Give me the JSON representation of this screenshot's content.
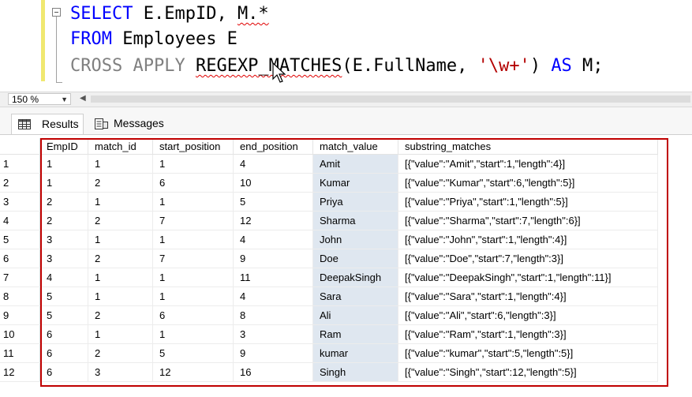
{
  "editor": {
    "line1": {
      "kw_select": "SELECT",
      "rest": " E.EmpID, ",
      "m_star": "M.*"
    },
    "line2": {
      "kw_from": "FROM",
      "rest": " Employees E"
    },
    "line3": {
      "kw_cross_apply": "CROSS APPLY",
      "fn_name": "REGEXP_MATCHES",
      "args_open": "(E.FullName, ",
      "pattern": "'\\w+'",
      "close": ")",
      "kw_as": "AS",
      "alias": " M;"
    }
  },
  "zoom": {
    "value": "150 %"
  },
  "tabs": {
    "results": "Results",
    "messages": "Messages"
  },
  "grid": {
    "columns": [
      "EmpID",
      "match_id",
      "start_position",
      "end_position",
      "match_value",
      "substring_matches"
    ],
    "rows": [
      {
        "n": "1",
        "empid": "1",
        "match_id": "1",
        "start": "1",
        "end": "4",
        "value": "Amit",
        "sub": "[{\"value\":\"Amit\",\"start\":1,\"length\":4}]"
      },
      {
        "n": "2",
        "empid": "1",
        "match_id": "2",
        "start": "6",
        "end": "10",
        "value": "Kumar",
        "sub": "[{\"value\":\"Kumar\",\"start\":6,\"length\":5}]"
      },
      {
        "n": "3",
        "empid": "2",
        "match_id": "1",
        "start": "1",
        "end": "5",
        "value": "Priya",
        "sub": "[{\"value\":\"Priya\",\"start\":1,\"length\":5}]"
      },
      {
        "n": "4",
        "empid": "2",
        "match_id": "2",
        "start": "7",
        "end": "12",
        "value": "Sharma",
        "sub": "[{\"value\":\"Sharma\",\"start\":7,\"length\":6}]"
      },
      {
        "n": "5",
        "empid": "3",
        "match_id": "1",
        "start": "1",
        "end": "4",
        "value": "John",
        "sub": "[{\"value\":\"John\",\"start\":1,\"length\":4}]"
      },
      {
        "n": "6",
        "empid": "3",
        "match_id": "2",
        "start": "7",
        "end": "9",
        "value": "Doe",
        "sub": "[{\"value\":\"Doe\",\"start\":7,\"length\":3}]"
      },
      {
        "n": "7",
        "empid": "4",
        "match_id": "1",
        "start": "1",
        "end": "11",
        "value": "DeepakSingh",
        "sub": "[{\"value\":\"DeepakSingh\",\"start\":1,\"length\":11}]"
      },
      {
        "n": "8",
        "empid": "5",
        "match_id": "1",
        "start": "1",
        "end": "4",
        "value": "Sara",
        "sub": "[{\"value\":\"Sara\",\"start\":1,\"length\":4}]"
      },
      {
        "n": "9",
        "empid": "5",
        "match_id": "2",
        "start": "6",
        "end": "8",
        "value": "Ali",
        "sub": "[{\"value\":\"Ali\",\"start\":6,\"length\":3}]"
      },
      {
        "n": "10",
        "empid": "6",
        "match_id": "1",
        "start": "1",
        "end": "3",
        "value": "Ram",
        "sub": "[{\"value\":\"Ram\",\"start\":1,\"length\":3}]"
      },
      {
        "n": "11",
        "empid": "6",
        "match_id": "2",
        "start": "5",
        "end": "9",
        "value": "kumar",
        "sub": "[{\"value\":\"kumar\",\"start\":5,\"length\":5}]"
      },
      {
        "n": "12",
        "empid": "6",
        "match_id": "3",
        "start": "12",
        "end": "16",
        "value": "Singh",
        "sub": "[{\"value\":\"Singh\",\"start\":12,\"length\":5}]"
      }
    ]
  },
  "colors": {
    "keyword": "#0000ff",
    "string": "#b30000",
    "selection_border": "#c00000",
    "match_value_bg": "#dfe7f0"
  },
  "icons": {
    "results": "grid-icon",
    "messages": "messages-icon",
    "cursor": "mouse-pointer-icon"
  }
}
